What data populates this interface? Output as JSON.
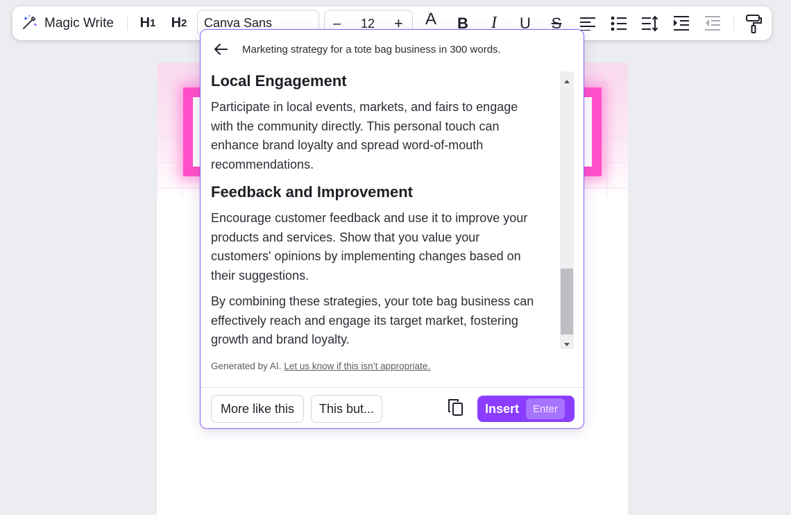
{
  "toolbar": {
    "magic_write_label": "Magic Write",
    "heading1_label": "H",
    "heading1_sub": "1",
    "heading2_label": "H",
    "heading2_sub": "2",
    "font_family": "Canva Sans",
    "font_size": "12",
    "decrease_label": "–",
    "increase_label": "+",
    "text_color_label": "A",
    "bold_label": "B",
    "italic_label": "I",
    "underline_label": "U",
    "strikethrough_label": "S",
    "icons": [
      "magic-wand-icon",
      "align-left-icon",
      "bullet-list-icon",
      "line-spacing-icon",
      "indent-icon",
      "outdent-icon",
      "paint-roller-icon"
    ]
  },
  "popup": {
    "prompt": "Marketing strategy for a tote bag business in 300 words.",
    "sections": [
      {
        "heading": "Local Engagement",
        "paragraph_lines": [
          "Participate in local events, markets, and fairs to engage",
          "with the community directly. This personal touch can",
          "enhance brand loyalty and spread word-of-mouth",
          "recommendations."
        ]
      },
      {
        "heading": "Feedback and Improvement",
        "paragraph_lines": [
          "Encourage customer feedback and use it to improve your",
          "products and services. Show that you value your",
          "customers' opinions by implementing changes based on",
          "their suggestions."
        ]
      }
    ],
    "closing_lines": [
      "By combining these strategies, your tote bag business can",
      "effectively reach and engage its target market, fostering",
      "growth and brand loyalty."
    ],
    "disclaimer_text": "Generated by AI.",
    "disclaimer_link": "Let us know if this isn’t appropriate.",
    "more_like_this_label": "More like this",
    "this_but_label": "This but...",
    "insert_label": "Insert",
    "insert_shortcut": "Enter"
  },
  "colors": {
    "accent": "#8b3dff",
    "popup_border": "#8b5cf6",
    "design_pink": "#ff4fc8"
  }
}
